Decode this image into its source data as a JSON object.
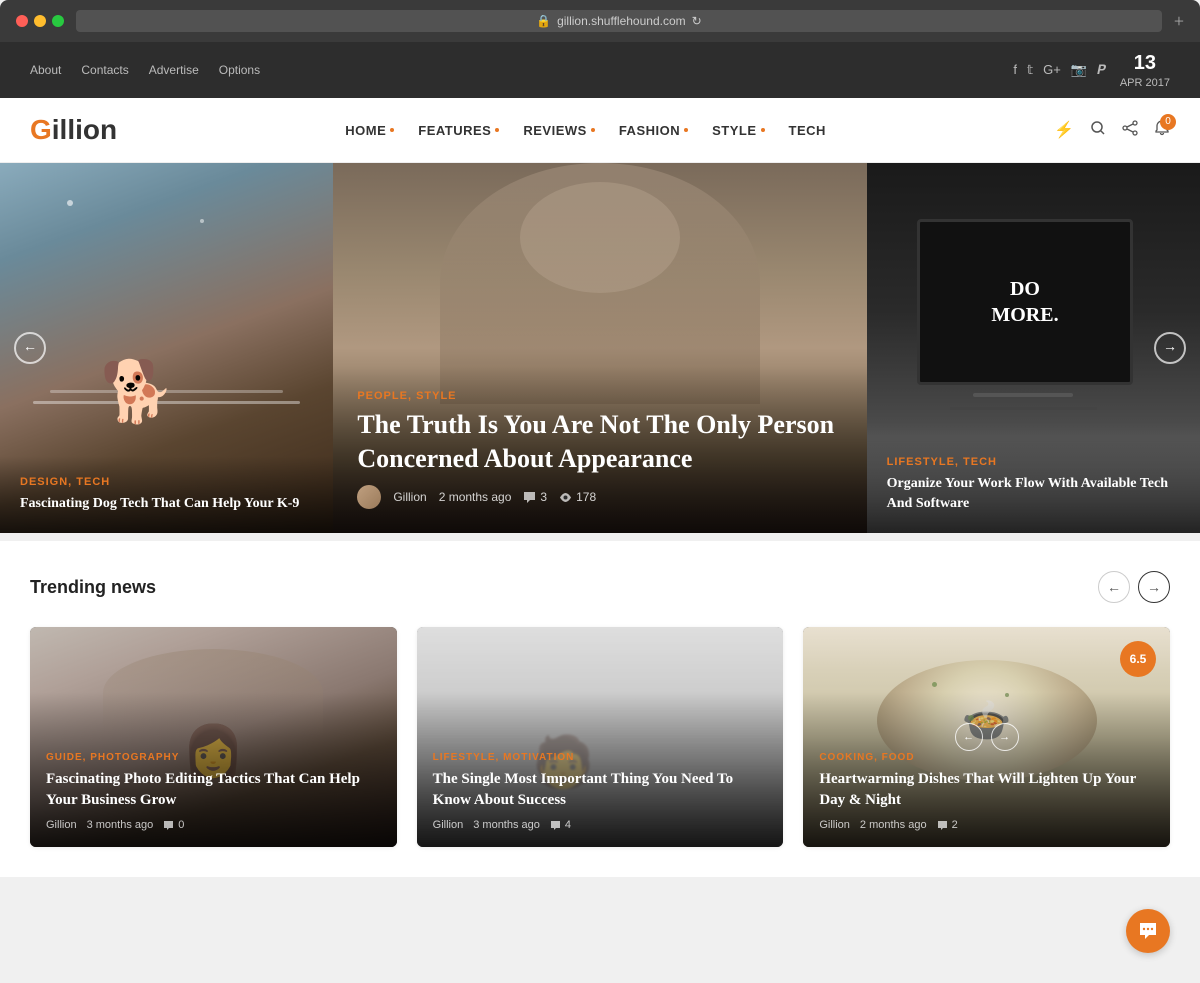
{
  "browser": {
    "url": "gillion.shufflehound.com",
    "plus_icon": "+"
  },
  "topbar": {
    "nav_items": [
      "About",
      "Contacts",
      "Advertise",
      "Options"
    ],
    "social": [
      "f",
      "t",
      "G+",
      "📷",
      "p"
    ],
    "date_day": "13",
    "date_month": "APR",
    "date_year": "2017"
  },
  "header": {
    "logo_first": "G",
    "logo_rest": "illion",
    "nav": [
      {
        "label": "HOME",
        "has_dot": true
      },
      {
        "label": "FEATURES",
        "has_dot": true
      },
      {
        "label": "REVIEWS",
        "has_dot": true
      },
      {
        "label": "FASHION",
        "has_dot": true
      },
      {
        "label": "STYLE",
        "has_dot": true
      },
      {
        "label": "TECH",
        "has_dot": false
      }
    ],
    "notification_count": "0"
  },
  "hero": {
    "left_card": {
      "categories": "DESIGN, TECH",
      "title": "Fascinating Dog Tech That Can Help Your K-9"
    },
    "center_card": {
      "categories": "PEOPLE, STYLE",
      "title": "The Truth Is You Are Not The Only Person Concerned About Appearance",
      "author": "Gillion",
      "time": "2 months ago",
      "comments": "3",
      "views": "178"
    },
    "right_card": {
      "categories": "LIFESTYLE, TECH",
      "title": "Organize Your Work Flow With Available Tech And Software"
    }
  },
  "trending": {
    "section_title": "Trending news",
    "prev_label": "←",
    "next_label": "→",
    "cards": [
      {
        "categories": "GUIDE, PHOTOGRAPHY",
        "title": "Fascinating Photo Editing Tactics That Can Help Your Business Grow",
        "author": "Gillion",
        "time": "3 months ago",
        "comments": "0"
      },
      {
        "categories": "LIFESTYLE, MOTIVATION",
        "title": "The Single Most Important Thing You Need To Know About Success",
        "author": "Gillion",
        "time": "3 months ago",
        "comments": "4"
      },
      {
        "categories": "COOKING, FOOD",
        "title": "Heartwarming Dishes That Will Lighten Up Your Day & Night",
        "author": "Gillion",
        "time": "2 months ago",
        "comments": "2",
        "rating": "6.5"
      }
    ]
  },
  "icons": {
    "flash": "⚡",
    "search": "🔍",
    "share": "↗",
    "bell": "🔔",
    "chat": "💬",
    "comment": "💬",
    "eye": "👁",
    "left_arrow": "←",
    "right_arrow": "→"
  }
}
